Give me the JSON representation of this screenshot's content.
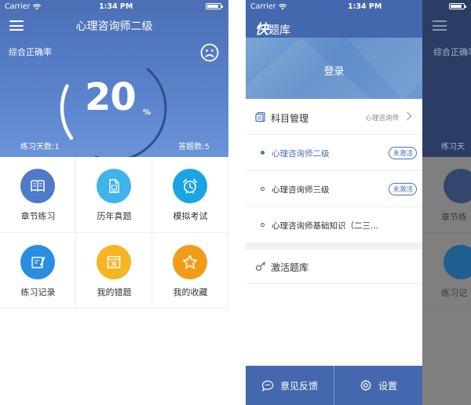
{
  "left": {
    "status": {
      "carrier": "Carrier",
      "time": "1:34 PM"
    },
    "title": "心理咨询师二级",
    "accuracy_label": "综合正确率",
    "percent": "20",
    "percent_unit": "%",
    "gauge_fraction": 0.2,
    "practice_days": "练习天数:1",
    "answer_count": "答题数:5",
    "grid": [
      {
        "label": "章节练习",
        "color": "#4e7ac7",
        "icon": "book-icon"
      },
      {
        "label": "历年真题",
        "color": "#3fb4ea",
        "icon": "paper-icon"
      },
      {
        "label": "模拟考试",
        "color": "#1ba4e5",
        "icon": "alarm-clock-icon"
      },
      {
        "label": "练习记录",
        "color": "#2a8ee0",
        "icon": "edit-note-icon"
      },
      {
        "label": "我的错题",
        "color": "#f5b623",
        "icon": "wrong-box-icon"
      },
      {
        "label": "我的收藏",
        "color": "#f29d1a",
        "icon": "star-icon"
      }
    ]
  },
  "right": {
    "status": {
      "carrier": "Carrier",
      "time": "1:34 PM"
    },
    "brand_bold": "快",
    "brand_rest": "题库",
    "login": "登录",
    "subject_manage": "科目管理",
    "subject_current": "心理咨询师",
    "exams": [
      {
        "name": "心理咨询师二级",
        "badge": "未激活",
        "active": true
      },
      {
        "name": "心理咨询师三级",
        "badge": "未激活",
        "active": false
      },
      {
        "name": "心理咨询师基础知识（二三...",
        "badge": "",
        "active": false
      }
    ],
    "activate": "激活题库",
    "feedback": "意见反馈",
    "settings": "设置",
    "peek": {
      "accuracy_label": "综合正确率",
      "days_label": "练习天",
      "item1": "章节练",
      "item2": "练习记"
    }
  },
  "colors": {
    "primary": "#4468ad",
    "accent": "#4a6fb5"
  }
}
